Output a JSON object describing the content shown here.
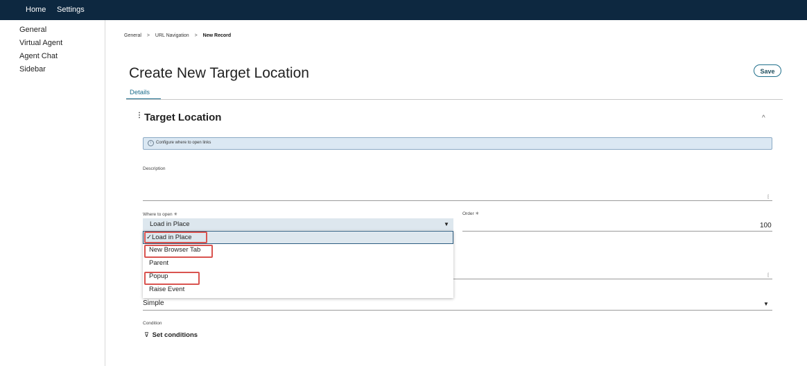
{
  "topnav": {
    "home": "Home",
    "settings": "Settings"
  },
  "sidebar": {
    "items": [
      {
        "label": "General"
      },
      {
        "label": "Virtual Agent"
      },
      {
        "label": "Agent Chat"
      },
      {
        "label": "Sidebar"
      }
    ]
  },
  "breadcrumb": {
    "items": [
      "General",
      "URL Navigation"
    ],
    "separator": ">",
    "current": "New Record"
  },
  "page": {
    "title": "Create New Target Location",
    "save_label": "Save"
  },
  "tabs": [
    {
      "label": "Details"
    }
  ],
  "section": {
    "title": "Target Location",
    "collapse_icon": "^"
  },
  "info": {
    "text": "Configure where to open links"
  },
  "description": {
    "label": "Description"
  },
  "where_to_open": {
    "label": "Where to open",
    "required_mark": "✳",
    "value": "Load in Place",
    "options": [
      "✓Load in Place",
      "New Browser Tab",
      "Parent",
      "Popup",
      "Raise Event"
    ]
  },
  "order": {
    "label": "Order",
    "required_mark": "✳",
    "value": "100"
  },
  "condition_type": {
    "value": "Simple"
  },
  "condition": {
    "label": "Condition",
    "filter_icon": "⊽",
    "set_label": "Set conditions"
  },
  "colors": {
    "topbar": "#0d2840",
    "accent": "#1b6b8a",
    "highlight": "#d9534f",
    "info_bg": "#dbe8f3"
  }
}
